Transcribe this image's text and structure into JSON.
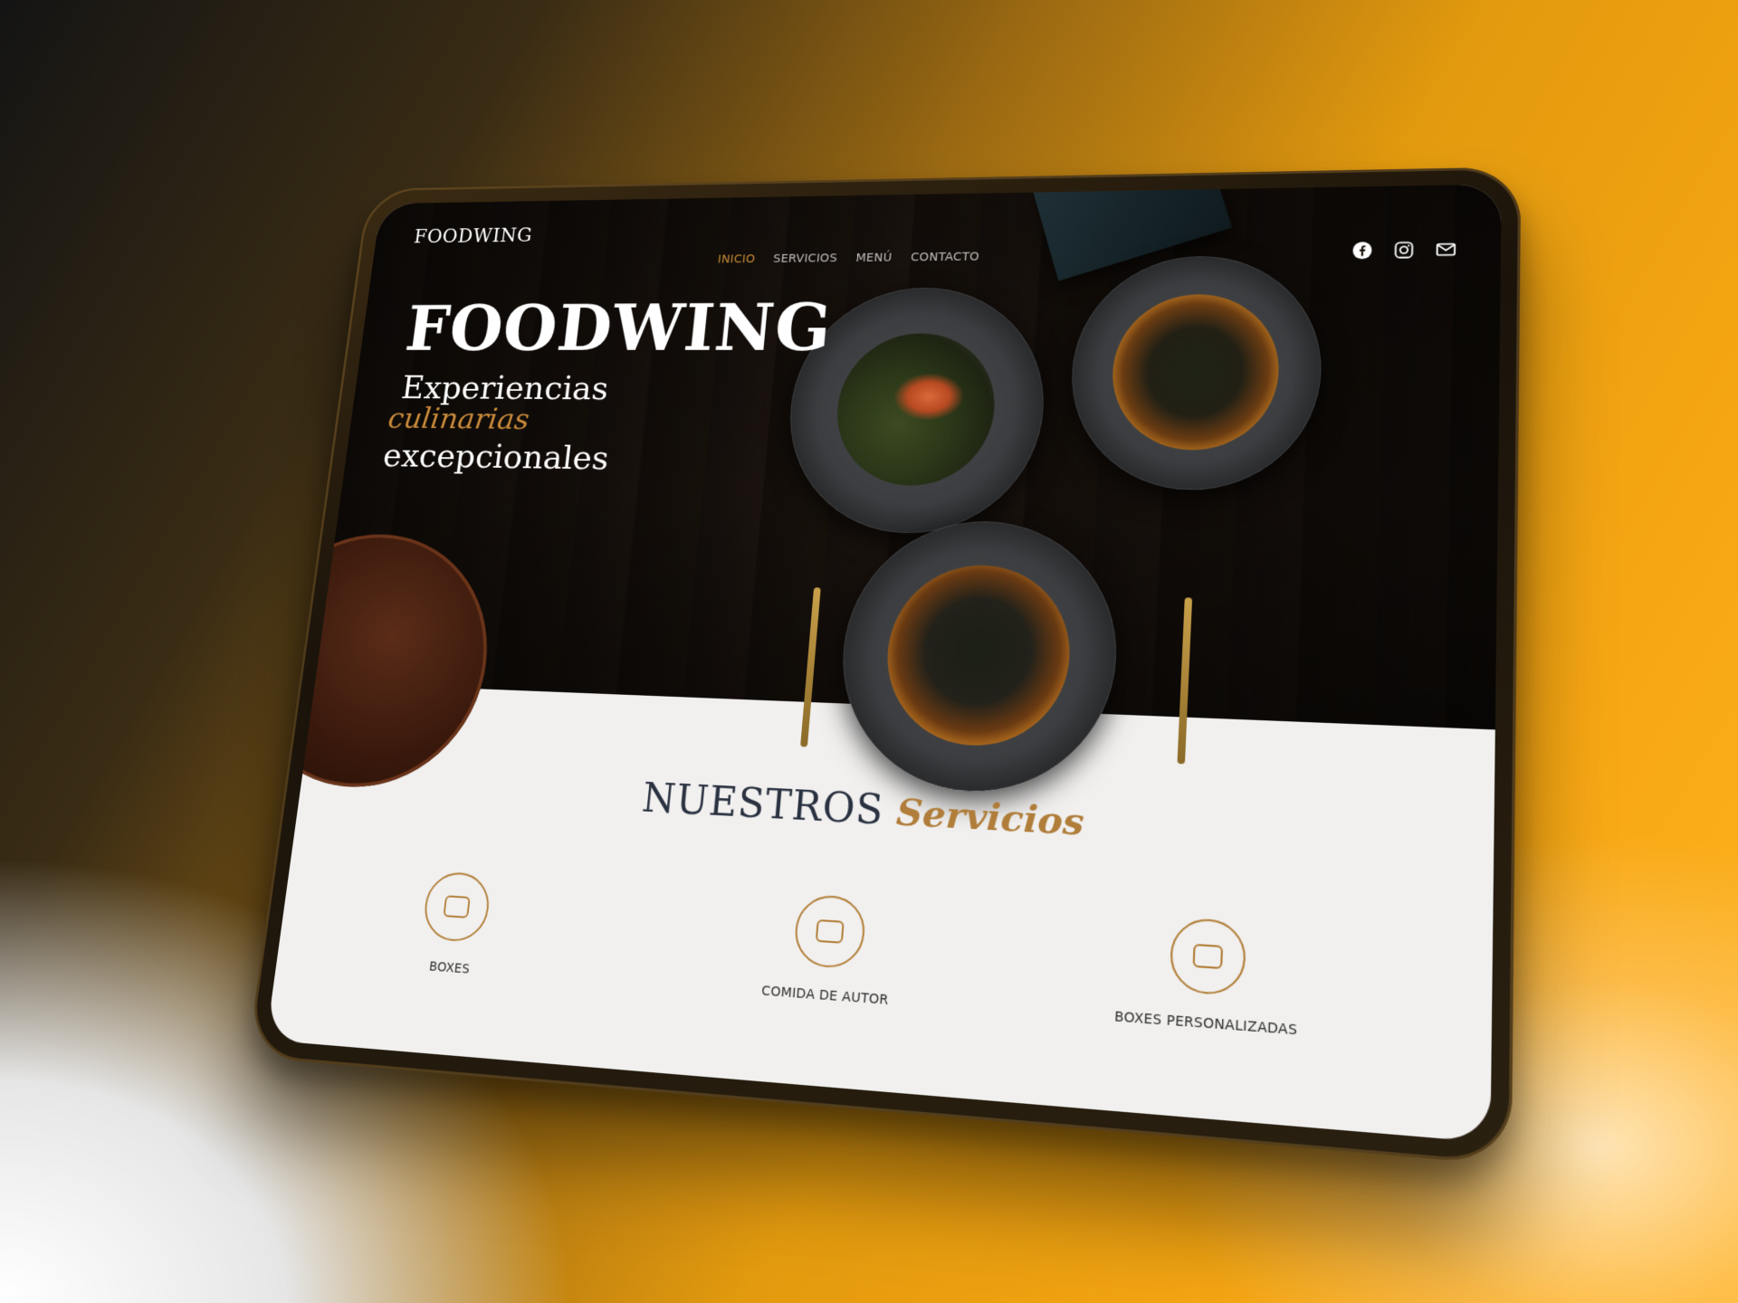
{
  "site": {
    "brand": "FOODWING"
  },
  "nav": {
    "items": [
      {
        "label": "INICIO",
        "active": true
      },
      {
        "label": "SERVICIOS"
      },
      {
        "label": "MENÚ"
      },
      {
        "label": "CONTACTO"
      }
    ]
  },
  "socials": [
    "facebook-icon",
    "instagram-icon",
    "mail-icon"
  ],
  "hero": {
    "title": "FOODWING",
    "line1": "Experiencias",
    "accent": "culinarias",
    "line2": "excepcionales"
  },
  "services": {
    "title_word": "NUESTROS",
    "title_script": "Servicios",
    "items": [
      {
        "label": "BOXES",
        "icon": "box-icon"
      },
      {
        "label": "COMIDA DE AUTOR",
        "icon": "box-icon"
      },
      {
        "label": "BOXES PERSONALIZADAS",
        "icon": "box-icon"
      }
    ]
  },
  "colors": {
    "accent": "#b27f38",
    "nav_active": "#c58a34",
    "heading": "#2a3140"
  }
}
